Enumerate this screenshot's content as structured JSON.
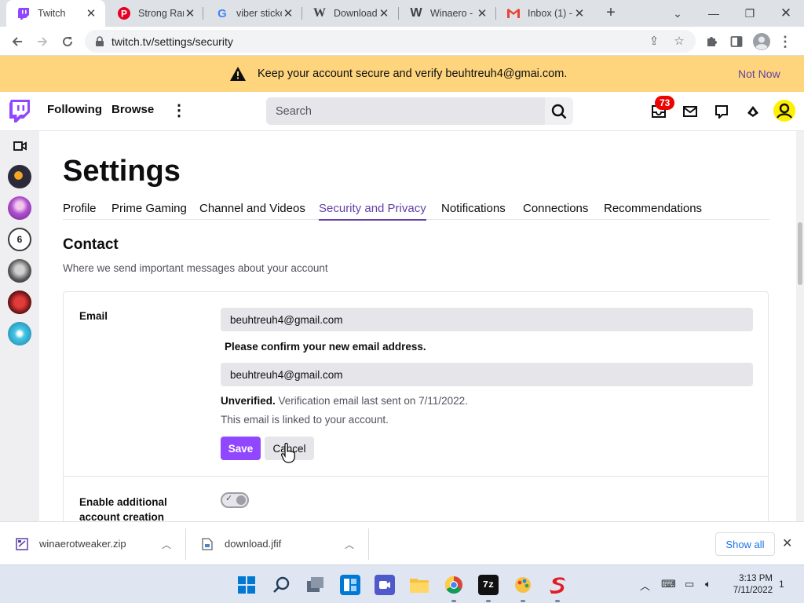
{
  "browser": {
    "tabs": [
      {
        "title": "Twitch",
        "icon": "twitch-favicon",
        "active": true
      },
      {
        "title": "Strong Ran",
        "icon": "pinterest-favicon"
      },
      {
        "title": "viber sticke",
        "icon": "google-favicon"
      },
      {
        "title": "Download",
        "icon": "wikipedia-favicon"
      },
      {
        "title": "Winaero - ",
        "icon": "winaero-favicon"
      },
      {
        "title": "Inbox (1) -",
        "icon": "gmail-favicon"
      }
    ],
    "url": "twitch.tv/settings/security"
  },
  "banner": {
    "message": "Keep your account secure and verify beuhtreuh4@gmai.com.",
    "action": "Not Now"
  },
  "topnav": {
    "following": "Following",
    "browse": "Browse",
    "search_placeholder": "Search",
    "notification_count": "73"
  },
  "settings": {
    "title": "Settings",
    "tabs": [
      {
        "label": "Profile"
      },
      {
        "label": "Prime Gaming"
      },
      {
        "label": "Channel and Videos"
      },
      {
        "label": "Security and Privacy",
        "active": true
      },
      {
        "label": "Notifications"
      },
      {
        "label": "Connections"
      },
      {
        "label": "Recommendations"
      }
    ],
    "contact": {
      "title": "Contact",
      "subtitle": "Where we send important messages about your account",
      "email_label": "Email",
      "email_value": "beuhtreuh4@gmail.com",
      "confirm_label": "Please confirm your new email address.",
      "confirm_value": "beuhtreuh4@gmail.com",
      "unverified_bold": "Unverified.",
      "unverified_text": " Verification email last sent on 7/11/2022.",
      "linked_text": "This email is linked to your account.",
      "save": "Save",
      "cancel": "Cancel",
      "additional_label": "Enable additional account creation"
    }
  },
  "downloads": {
    "items": [
      {
        "name": "winaerotweaker.zip"
      },
      {
        "name": "download.jfif"
      }
    ],
    "show_all": "Show all"
  },
  "taskbar": {
    "time": "3:13 PM",
    "date": "7/11/2022",
    "notifications": "1"
  },
  "colors": {
    "twitch_purple": "#9147ff",
    "active_tab": "#6441a5",
    "banner": "#fed57d",
    "badge": "#eb0400"
  }
}
